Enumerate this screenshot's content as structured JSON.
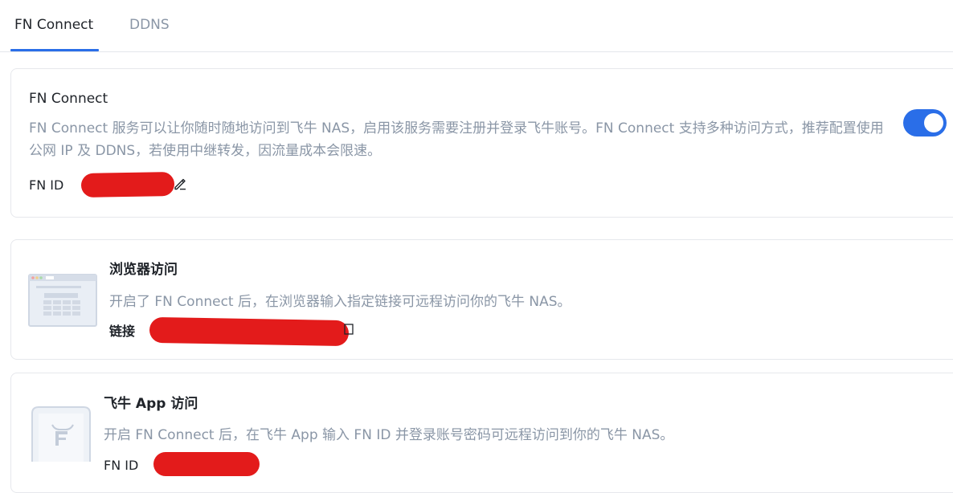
{
  "tabs": [
    {
      "label": "FN Connect",
      "active": true
    },
    {
      "label": "DDNS",
      "active": false
    }
  ],
  "fn_connect_card": {
    "title": "FN Connect",
    "description": "FN Connect 服务可以让你随时随地访问到飞牛 NAS，启用该服务需要注册并登录飞牛账号。FN Connect 支持多种访问方式，推荐配置使用公网 IP 及 DDNS，若使用中继转发，因流量成本会限速。",
    "id_label": "FN ID",
    "enabled": true
  },
  "browser_card": {
    "title": "浏览器访问",
    "description": "开启了 FN Connect 后，在浏览器输入指定链接可远程访问你的飞牛 NAS。",
    "link_label": "链接"
  },
  "app_card": {
    "title": "飞牛 App 访问",
    "description": "开启 FN Connect 后，在飞牛 App 输入 FN ID 并登录账号密码可远程访问到你的飞牛 NAS。",
    "id_label": "FN ID"
  },
  "colors": {
    "accent": "#2a6ee8",
    "muted_text": "#8a96a6",
    "redaction": "#e31b1b"
  },
  "icons": {
    "edit": "pencil-icon",
    "copy": "copy-icon",
    "browser": "browser-window-icon",
    "app": "app-phone-icon"
  }
}
